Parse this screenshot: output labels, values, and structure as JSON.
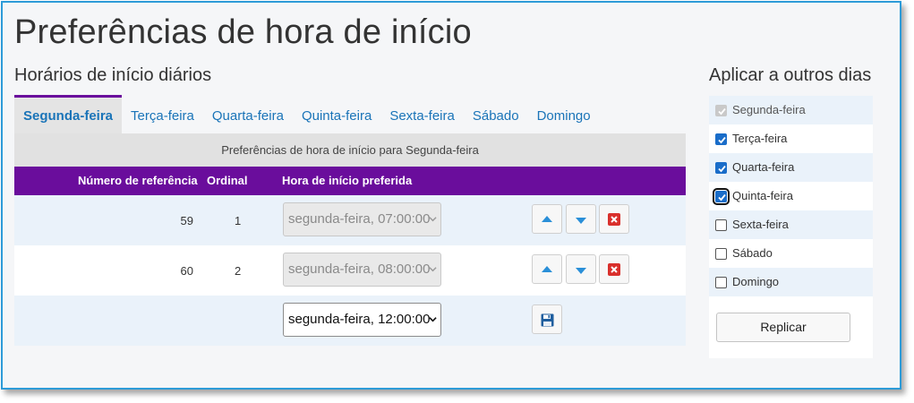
{
  "page": {
    "title": "Preferências de hora de início"
  },
  "daily": {
    "section_title": "Horários de início diários",
    "tabs": [
      {
        "label": "Segunda-feira",
        "active": true
      },
      {
        "label": "Terça-feira",
        "active": false
      },
      {
        "label": "Quarta-feira",
        "active": false
      },
      {
        "label": "Quinta-feira",
        "active": false
      },
      {
        "label": "Sexta-feira",
        "active": false
      },
      {
        "label": "Sábado",
        "active": false
      },
      {
        "label": "Domingo",
        "active": false
      }
    ],
    "subheader": "Preferências de hora de início para Segunda-feira",
    "columns": {
      "reference": "Número de referência",
      "ordinal": "Ordinal",
      "preferred": "Hora de início preferida"
    },
    "rows": [
      {
        "reference": "59",
        "ordinal": "1",
        "time": "segunda-feira, 07:00:00",
        "enabled": false
      },
      {
        "reference": "60",
        "ordinal": "2",
        "time": "segunda-feira, 08:00:00",
        "enabled": false
      },
      {
        "reference": "",
        "ordinal": "",
        "time": "segunda-feira, 12:00:00",
        "enabled": true
      }
    ]
  },
  "apply": {
    "title": "Aplicar a outros dias",
    "days": [
      {
        "label": "Segunda-feira",
        "checked": true,
        "disabled": true
      },
      {
        "label": "Terça-feira",
        "checked": true,
        "disabled": false
      },
      {
        "label": "Quarta-feira",
        "checked": true,
        "disabled": false
      },
      {
        "label": "Quinta-feira",
        "checked": true,
        "disabled": false,
        "focused": true
      },
      {
        "label": "Sexta-feira",
        "checked": false,
        "disabled": false
      },
      {
        "label": "Sábado",
        "checked": false,
        "disabled": false
      },
      {
        "label": "Domingo",
        "checked": false,
        "disabled": false
      }
    ],
    "button_label": "Replicar"
  },
  "colors": {
    "accent": "#6a0d9c",
    "link": "#1a74b8",
    "frame_border": "#2d9bd8",
    "up_down_icon": "#2a8fd8",
    "delete_icon": "#d9302c",
    "save_icon": "#1f5e9e"
  },
  "icons": {
    "move_up": "arrow-up-icon",
    "move_down": "arrow-down-icon",
    "delete": "delete-x-icon",
    "save": "floppy-save-icon",
    "checkmark": "checkmark-icon",
    "caret": "chevron-down-icon"
  }
}
